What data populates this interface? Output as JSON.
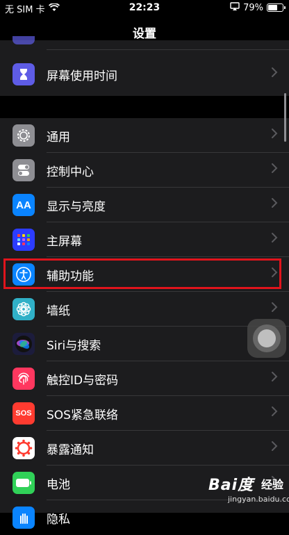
{
  "status_bar": {
    "carrier": "无 SIM 卡",
    "time": "22:23",
    "battery_text": "79%",
    "battery_level": 0.79
  },
  "nav": {
    "title": "设置"
  },
  "top_group": [
    {
      "label": "屏幕使用时间",
      "icon": "hourglass-icon",
      "color": "#5e5ce6"
    }
  ],
  "main_group": [
    {
      "label": "通用",
      "icon": "gear-icon",
      "color": "#8e8e93"
    },
    {
      "label": "控制中心",
      "icon": "toggle-icon",
      "color": "#8e8e93"
    },
    {
      "label": "显示与亮度",
      "icon": "text-size-icon",
      "color": "#0a84ff"
    },
    {
      "label": "主屏幕",
      "icon": "home-grid-icon",
      "color": "#2c3cff"
    },
    {
      "label": "辅助功能",
      "icon": "accessibility-icon",
      "color": "#0a84ff"
    },
    {
      "label": "墙纸",
      "icon": "flower-icon",
      "color": "#30b0c7"
    },
    {
      "label": "Siri与搜索",
      "icon": "siri-icon",
      "color": "#1c1c3c"
    },
    {
      "label": "触控ID与密码",
      "icon": "fingerprint-icon",
      "color": "#ff375f"
    },
    {
      "label": "SOS紧急联络",
      "icon": "sos-icon",
      "color": "#ff3b30"
    },
    {
      "label": "暴露通知",
      "icon": "exposure-icon",
      "color": "#ff3b30"
    },
    {
      "label": "电池",
      "icon": "battery-icon",
      "color": "#30d158"
    },
    {
      "label": "隐私",
      "icon": "hand-icon",
      "color": "#0a84ff"
    }
  ],
  "watermark": {
    "logo": "Bai度",
    "brand": "经验",
    "url": "jingyan.baidu.com"
  }
}
